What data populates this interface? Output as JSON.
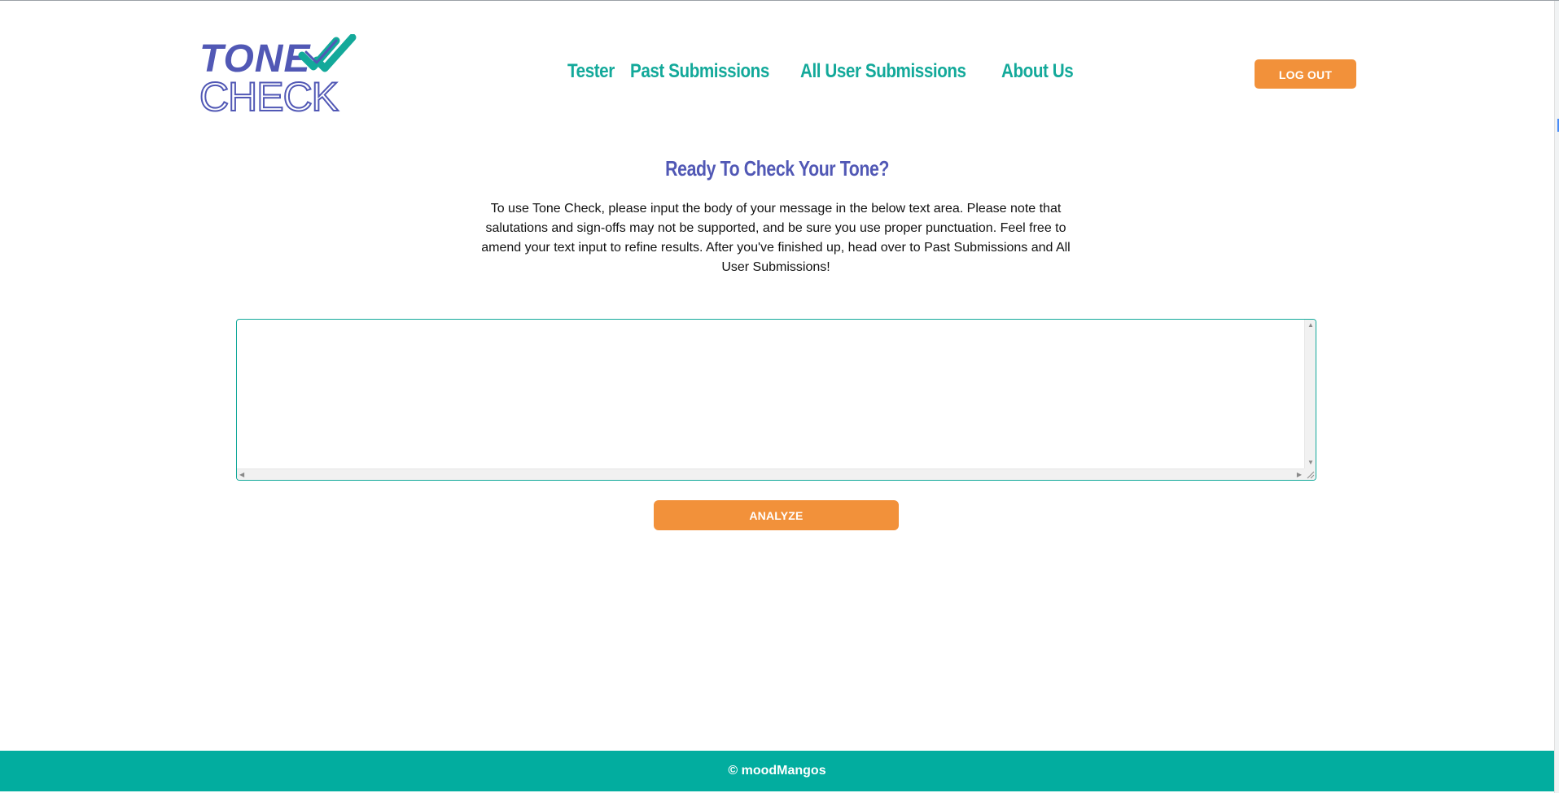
{
  "logo": {
    "word_top": "TONE",
    "word_bottom": "CHECK",
    "icon": "double-check-icon",
    "colors": {
      "primary": "#5158b5",
      "accent": "#13a99a"
    }
  },
  "nav": {
    "items": [
      {
        "label": "Tester"
      },
      {
        "label": "Past Submissions"
      },
      {
        "label": "All User Submissions"
      },
      {
        "label": "About Us"
      }
    ]
  },
  "header": {
    "logout_label": "LOG OUT"
  },
  "main": {
    "title": "Ready To Check Your Tone?",
    "intro": "To use Tone Check, please input the body of your message in the below text area. Please note that salutations and sign-offs may not be supported, and be sure you use proper punctuation. Feel free to amend your text input to refine results. After you've finished up, head over to Past Submissions and All User Submissions!",
    "textarea_value": "",
    "analyze_label": "ANALYZE"
  },
  "footer": {
    "text": "© moodMangos"
  },
  "colors": {
    "teal": "#13a99a",
    "footer_teal": "#02ad9f",
    "orange": "#f2913a",
    "indigo": "#5158b5"
  }
}
